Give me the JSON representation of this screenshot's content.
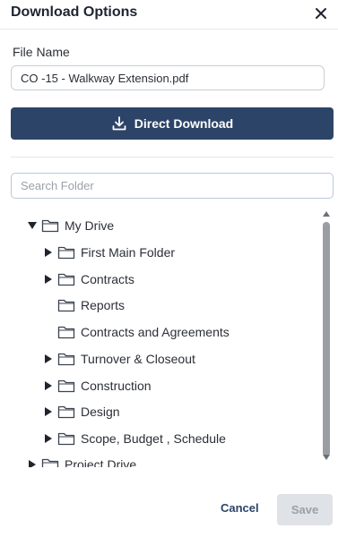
{
  "dialog": {
    "title": "Download Options"
  },
  "file": {
    "label": "File Name",
    "value": "CO -15 - Walkway Extension.pdf"
  },
  "download_button": {
    "label": "Direct Download",
    "icon": "download-icon"
  },
  "search": {
    "placeholder": "Search Folder"
  },
  "tree": {
    "root": {
      "label": "My Drive",
      "state": "expanded"
    },
    "items": [
      {
        "label": "First Main Folder",
        "has_children": true
      },
      {
        "label": "Contracts",
        "has_children": true
      },
      {
        "label": "Reports",
        "has_children": false
      },
      {
        "label": "Contracts and Agreements",
        "has_children": false
      },
      {
        "label": "Turnover & Closeout",
        "has_children": true
      },
      {
        "label": "Construction",
        "has_children": true
      },
      {
        "label": "Design",
        "has_children": true
      },
      {
        "label": "Scope, Budget , Schedule",
        "has_children": true
      }
    ],
    "next_root": {
      "label": "Project Drive",
      "state": "collapsed"
    }
  },
  "footer": {
    "cancel_label": "Cancel",
    "save_label": "Save"
  },
  "colors": {
    "primary": "#2c4468",
    "disabled_bg": "#dfe2e6",
    "disabled_text": "#9aa0a8"
  }
}
